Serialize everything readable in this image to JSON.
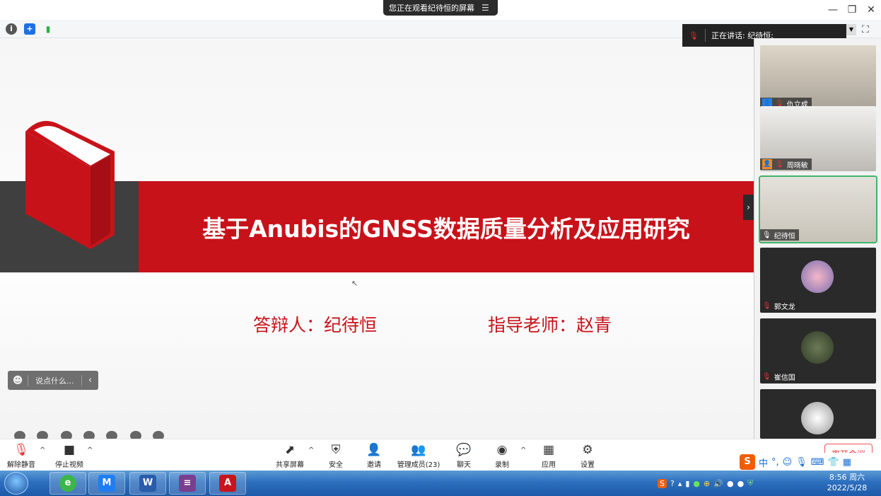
{
  "window": {
    "share_banner": "您正在观看纪待恒的屏幕",
    "minimize": "—",
    "restore": "❐",
    "close": "✕"
  },
  "speaking": {
    "label": "正在讲话: 纪待恒;"
  },
  "slide": {
    "title": "基于Anubis的GNSS数据质量分析及应用研究",
    "defender": "答辩人：纪待恒",
    "advisor": "指导老师：赵青",
    "brand_red": "#c8121a"
  },
  "chat": {
    "placeholder": "说点什么..."
  },
  "participants": [
    {
      "name": "仇立成",
      "muted": true,
      "video": true
    },
    {
      "name": "周晓敏",
      "muted": true,
      "video": true
    },
    {
      "name": "纪待恒",
      "muted": false,
      "video": true,
      "active": true
    },
    {
      "name": "郭文龙",
      "muted": true,
      "video": false
    },
    {
      "name": "崔信国",
      "muted": true,
      "video": false
    },
    {
      "name": "",
      "muted": true,
      "video": false
    }
  ],
  "toolbar": {
    "unmute": "解除静音",
    "stop_video": "停止视频",
    "share_screen": "共享屏幕",
    "security": "安全",
    "invite": "邀请",
    "manage_members": "管理成员(23)",
    "chat": "聊天",
    "record": "录制",
    "apps": "应用",
    "settings": "设置",
    "leave": "离开会议"
  },
  "ime": {
    "lang": "中"
  },
  "taskbar": {
    "time": "8:56 周六",
    "date": "2022/5/28"
  }
}
